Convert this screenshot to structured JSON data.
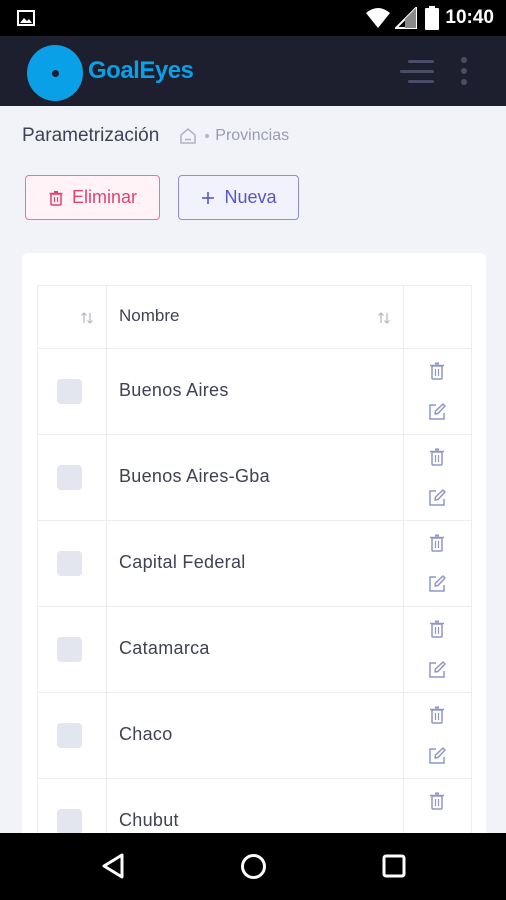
{
  "status_bar": {
    "time": "10:40",
    "icons": [
      "image-icon",
      "wifi-icon",
      "signal-icon",
      "battery-icon"
    ]
  },
  "app": {
    "brand": "GoalEyes",
    "brand_color": "#0aa0e8",
    "header_bg": "#1e1f2e"
  },
  "breadcrumb": {
    "title": "Parametrización",
    "items": [
      "Provincias"
    ]
  },
  "toolbar": {
    "delete_label": "Eliminar",
    "new_label": "Nueva",
    "delete_color": "#e0436f",
    "new_color": "#5557c9"
  },
  "table": {
    "columns": [
      "",
      "Nombre",
      ""
    ],
    "rows": [
      {
        "name": "Buenos Aires"
      },
      {
        "name": "Buenos Aires-Gba"
      },
      {
        "name": "Capital Federal"
      },
      {
        "name": "Catamarca"
      },
      {
        "name": "Chaco"
      },
      {
        "name": "Chubut"
      }
    ]
  },
  "nav": {
    "icons": [
      "back-icon",
      "home-icon",
      "recents-icon"
    ]
  }
}
